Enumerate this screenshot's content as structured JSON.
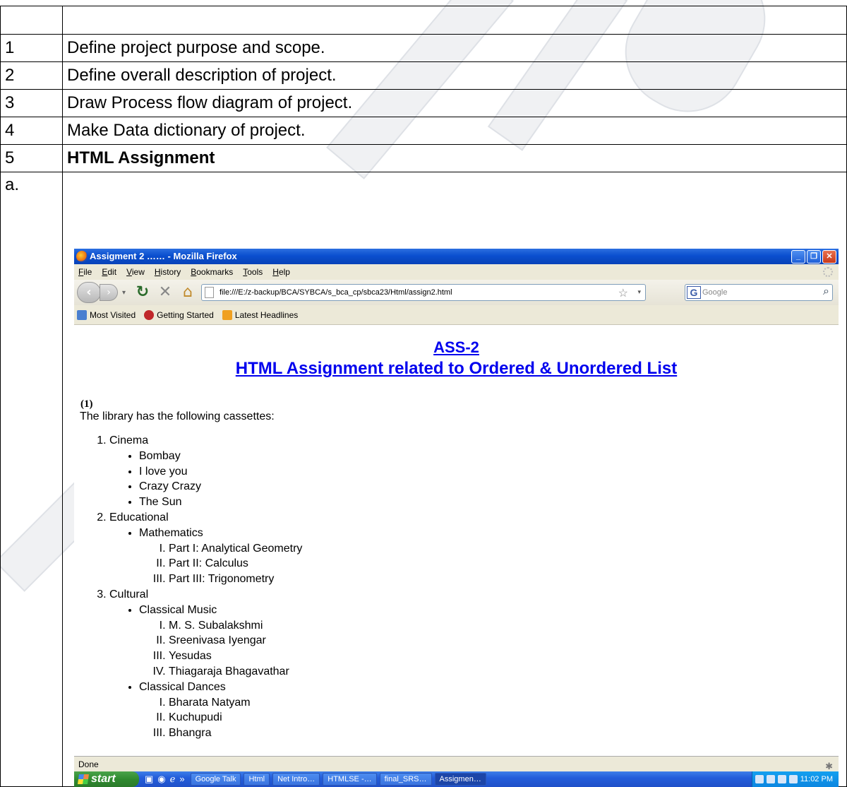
{
  "doc_rows": [
    {
      "num": "",
      "text": "",
      "bold": false
    },
    {
      "num": "1",
      "text": "Define project purpose and scope.",
      "bold": false
    },
    {
      "num": "2",
      "text": "Define overall description of project.",
      "bold": false
    },
    {
      "num": "3",
      "text": "Draw Process flow diagram of project.",
      "bold": false
    },
    {
      "num": "4",
      "text": "Make Data dictionary of project.",
      "bold": false
    },
    {
      "num": "5",
      "text": "HTML Assignment",
      "bold": true
    },
    {
      "num": "a.",
      "text": "",
      "bold": false
    }
  ],
  "browser": {
    "window_title": "Assigment 2 …… - Mozilla Firefox",
    "menu": [
      "File",
      "Edit",
      "View",
      "History",
      "Bookmarks",
      "Tools",
      "Help"
    ],
    "url": "file:///E:/z-backup/BCA/SYBCA/s_bca_cp/sbca23/Html/assign2.html",
    "search_placeholder": "Google",
    "bookmarks": [
      "Most Visited",
      "Getting Started",
      "Latest Headlines"
    ],
    "status": "Done"
  },
  "page": {
    "title1": "ASS-2",
    "title2": "HTML Assignment related to Ordered & Unordered List",
    "question": "(1)",
    "intro": "The library has the following cassettes:",
    "cinema": {
      "label": "Cinema",
      "items": [
        "Bombay",
        "I love you",
        "Crazy Crazy",
        "The Sun"
      ]
    },
    "educational": {
      "label": "Educational",
      "sub": "Mathematics",
      "items": [
        "Part I: Analytical Geometry",
        "Part II: Calculus",
        "Part III: Trigonometry"
      ]
    },
    "cultural": {
      "label": "Cultural",
      "music": {
        "label": "Classical Music",
        "items": [
          "M. S. Subalakshmi",
          "Sreenivasa Iyengar",
          "Yesudas",
          "Thiagaraja Bhagavathar"
        ]
      },
      "dances": {
        "label": "Classical Dances",
        "items": [
          "Bharata Natyam",
          "Kuchupudi",
          "Bhangra"
        ]
      }
    }
  },
  "taskbar": {
    "start": "start",
    "tasks": [
      "Google Talk",
      "Html",
      "Net Intro…",
      "HTMLSE -…",
      "final_SRS…",
      "Assigmen…"
    ],
    "clock": "11:02 PM"
  }
}
